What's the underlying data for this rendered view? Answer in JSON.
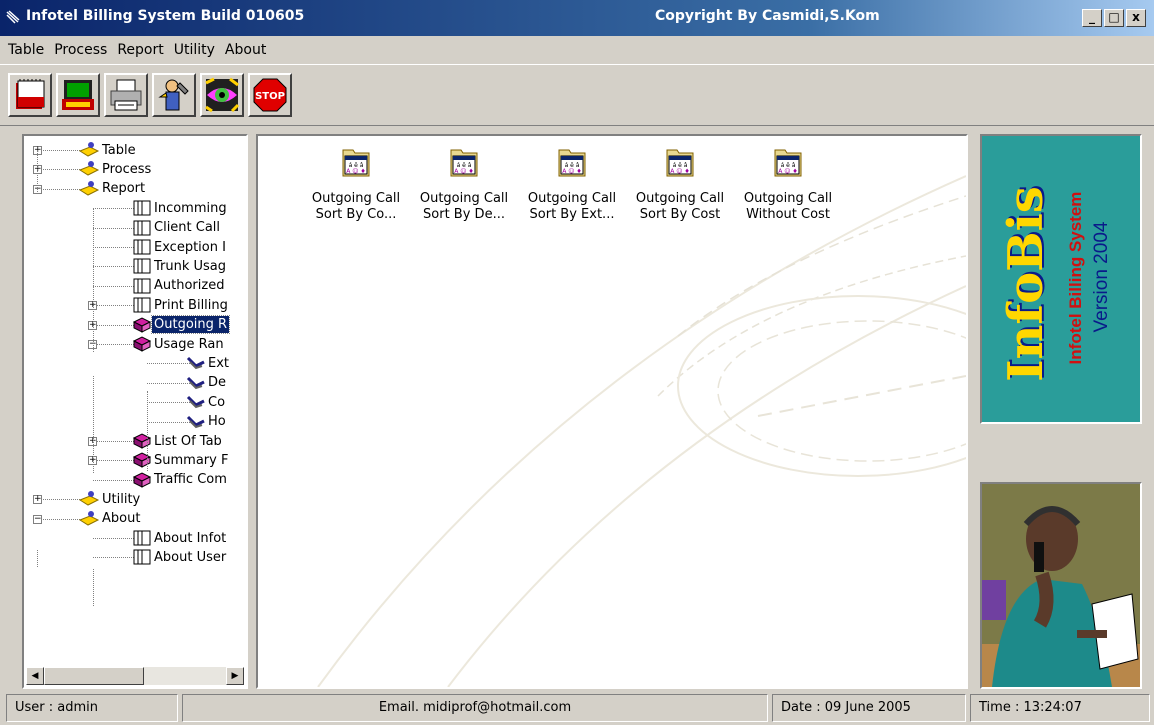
{
  "window": {
    "title": "Infotel Billing System  Build 010605",
    "copyright": "Copyright By Casmidi,S.Kom",
    "controls": [
      "_",
      "□",
      "x"
    ]
  },
  "menu": [
    "Table",
    "Process",
    "Report",
    "Utility",
    "About"
  ],
  "toolbar": [
    "table-book-icon",
    "phone-terminal-icon",
    "printer-icon",
    "tools-icon",
    "eye-icon",
    "stop-icon"
  ],
  "tree": {
    "nodes": [
      {
        "label": "Table",
        "expander": "+"
      },
      {
        "label": "Process",
        "expander": "+"
      },
      {
        "label": "Report",
        "expander": "−"
      },
      {
        "label": "Incomming"
      },
      {
        "label": "Client Call"
      },
      {
        "label": "Exception I"
      },
      {
        "label": "Trunk Usag"
      },
      {
        "label": "Authorized"
      },
      {
        "label": "Print Billing",
        "expander": "+"
      },
      {
        "label": "Outgoing R",
        "expander": "+",
        "selected": true
      },
      {
        "label": "Usage Ran",
        "expander": "−"
      },
      {
        "label": "Ext"
      },
      {
        "label": "De"
      },
      {
        "label": "Co"
      },
      {
        "label": "Ho"
      },
      {
        "label": "List Of Tab",
        "expander": "+"
      },
      {
        "label": "Summary F",
        "expander": "+"
      },
      {
        "label": "Traffic Com"
      },
      {
        "label": "Utility",
        "expander": "+"
      },
      {
        "label": "About",
        "expander": "−"
      },
      {
        "label": "About Infot"
      },
      {
        "label": "About User"
      }
    ]
  },
  "main_items": [
    {
      "line1": "Outgoing Call",
      "line2": "Sort By Co..."
    },
    {
      "line1": "Outgoing Call",
      "line2": "Sort By De..."
    },
    {
      "line1": "Outgoing Call",
      "line2": "Sort By Ext..."
    },
    {
      "line1": "Outgoing Call",
      "line2": "Sort By Cost"
    },
    {
      "line1": "Outgoing Call",
      "line2": "Without Cost"
    }
  ],
  "logo": {
    "name": "InfoBis",
    "subtitle": "Infotel Billing System",
    "version": "Version 2004"
  },
  "status": {
    "user": "User : admin",
    "email": "Email. midiprof@hotmail.com",
    "date": "Date : 09 June 2005",
    "time": "Time : 13:24:07"
  },
  "colors": {
    "title_start": "#0a246a",
    "logo_bg": "#2a9d9a",
    "logo_text": "#ffd700",
    "subtitle": "#d01010",
    "version": "#0a1a8a"
  }
}
